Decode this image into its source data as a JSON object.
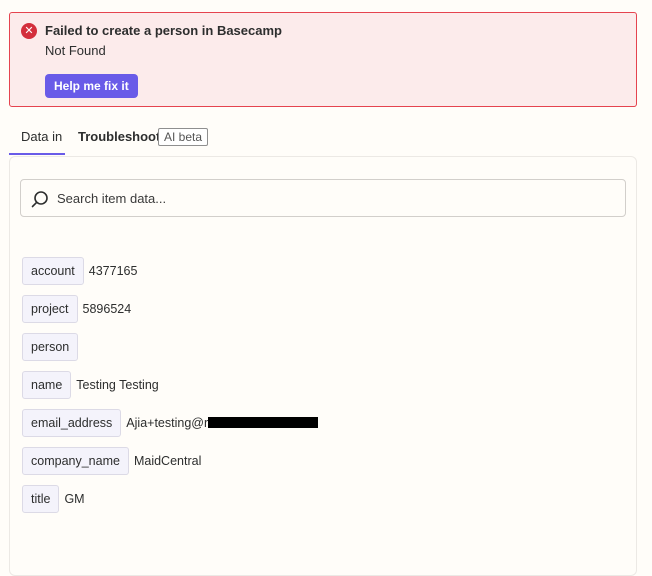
{
  "alert": {
    "icon": "error-x-icon",
    "title": "Failed to create a person in Basecamp",
    "detail": "Not Found",
    "action_label": "Help me fix it"
  },
  "tabs": [
    {
      "label": "Data in",
      "active": true
    },
    {
      "label": "Troubleshoot",
      "badge": "AI beta",
      "active": false
    }
  ],
  "search": {
    "placeholder": "Search item data...",
    "value": ""
  },
  "fields": [
    {
      "key": "account",
      "value": "4377165"
    },
    {
      "key": "project",
      "value": "5896524"
    },
    {
      "key": "person",
      "value": ""
    },
    {
      "key": "name",
      "value": "Testing Testing"
    },
    {
      "key": "email_address",
      "value": "Ajia+testing@r",
      "redacted": true
    },
    {
      "key": "company_name",
      "value": "MaidCentral"
    },
    {
      "key": "title",
      "value": "GM"
    }
  ],
  "colors": {
    "error_border": "#e5434f",
    "error_bg": "#fcebeb",
    "accent": "#695be8"
  }
}
